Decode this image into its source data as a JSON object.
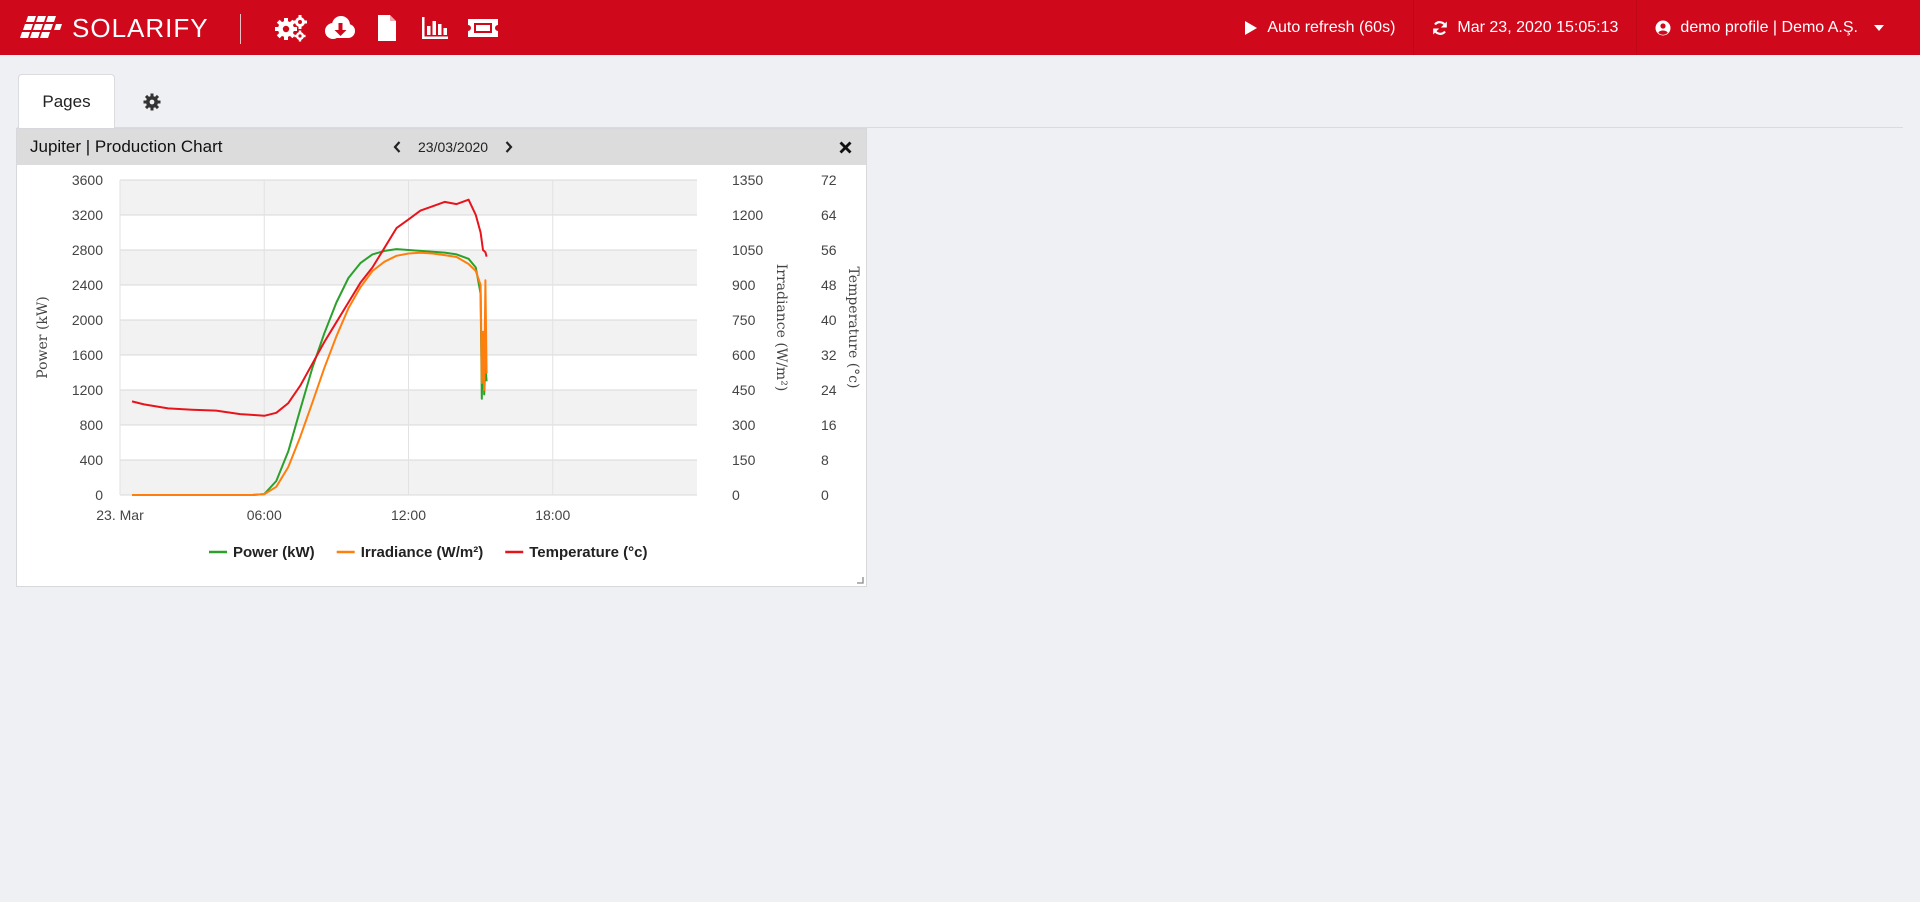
{
  "header": {
    "logo_text": "SOLARIFY",
    "tool_icons": [
      "settings-gears-icon",
      "cloud-download-icon",
      "file-icon",
      "bar-chart-icon",
      "ticket-icon"
    ],
    "auto_refresh_label": "Auto refresh (60s)",
    "timestamp": "Mar 23, 2020 15:05:13",
    "profile_label": "demo profile | Demo A.Ş.",
    "brand_color": "#d0081b"
  },
  "tabs": {
    "pages_label": "Pages"
  },
  "widget": {
    "title": "Jupiter | Production Chart",
    "date": "23/03/2020"
  },
  "chart_data": {
    "type": "line",
    "x_ticks": [
      "23. Mar",
      "06:00",
      "12:00",
      "18:00"
    ],
    "x_range_hours": [
      0,
      24
    ],
    "axes": {
      "left": {
        "label": "Power (kW)",
        "min": 0,
        "max": 3600,
        "ticks": [
          "0",
          "400",
          "800",
          "1200",
          "1600",
          "2000",
          "2400",
          "2800",
          "3200",
          "3600"
        ]
      },
      "right1": {
        "label": "Irradiance (W/m²)",
        "min": 0,
        "max": 1350,
        "ticks": [
          "0",
          "150",
          "300",
          "450",
          "600",
          "750",
          "900",
          "1050",
          "1200",
          "1350"
        ]
      },
      "right2": {
        "label": "Temperature (°c)",
        "min": 0,
        "max": 72,
        "ticks": [
          "0",
          "8",
          "16",
          "24",
          "32",
          "40",
          "48",
          "56",
          "64",
          "72"
        ]
      }
    },
    "legend_position": "bottom",
    "grid": true,
    "series": [
      {
        "name": "Power (kW)",
        "color": "#2ca02c",
        "axis": "left",
        "x": [
          0.5,
          1,
          2,
          3,
          4,
          5,
          5.5,
          6,
          6.5,
          7,
          7.5,
          8,
          8.5,
          9,
          9.5,
          10,
          10.5,
          11,
          11.5,
          12,
          12.5,
          13,
          13.5,
          14,
          14.5,
          14.8,
          15,
          15.05,
          15.1,
          15.15,
          15.2,
          15.25
        ],
        "y": [
          0,
          0,
          0,
          0,
          0,
          0,
          0,
          10,
          160,
          500,
          980,
          1450,
          1850,
          2200,
          2480,
          2650,
          2750,
          2790,
          2810,
          2800,
          2790,
          2780,
          2770,
          2750,
          2700,
          2600,
          2300,
          1100,
          1800,
          1150,
          1500,
          1300
        ]
      },
      {
        "name": "Irradiance (W/m²)",
        "color": "#ff7f0e",
        "axis": "right1",
        "x": [
          0.5,
          1,
          2,
          3,
          4,
          5,
          5.5,
          6,
          6.5,
          7,
          7.5,
          8,
          8.5,
          9,
          9.5,
          10,
          10.5,
          11,
          11.5,
          12,
          12.5,
          13,
          13.5,
          14,
          14.5,
          14.8,
          15,
          15.05,
          15.1,
          15.15,
          15.2,
          15.25
        ],
        "y": [
          0,
          0,
          0,
          0,
          0,
          0,
          0,
          4,
          35,
          120,
          250,
          395,
          545,
          680,
          800,
          890,
          960,
          1000,
          1025,
          1035,
          1038,
          1035,
          1028,
          1020,
          990,
          960,
          900,
          480,
          700,
          450,
          920,
          520
        ]
      },
      {
        "name": "Temperature (°c)",
        "color": "#e8141b",
        "axis": "right2",
        "x": [
          0.5,
          1,
          2,
          3,
          4,
          5,
          5.5,
          6,
          6.5,
          7,
          7.5,
          8,
          8.5,
          9,
          9.5,
          10,
          10.5,
          11,
          11.5,
          12,
          12.5,
          13,
          13.5,
          14,
          14.5,
          14.8,
          15,
          15.1,
          15.2,
          15.25
        ],
        "y": [
          21.4,
          20.7,
          19.8,
          19.5,
          19.3,
          18.5,
          18.3,
          18.1,
          18.8,
          21,
          25,
          30,
          35,
          39.5,
          44,
          48.5,
          52,
          56.5,
          61,
          63,
          65,
          66,
          67,
          66.5,
          67.5,
          64,
          60,
          56,
          55.5,
          54.5
        ]
      }
    ]
  }
}
